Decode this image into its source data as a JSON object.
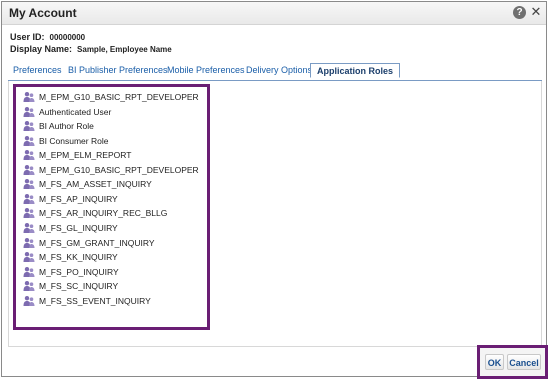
{
  "dialog": {
    "title": "My Account",
    "help_icon": "?",
    "close_icon": "✕"
  },
  "user": {
    "user_id_label": "User ID:",
    "user_id_value": "00000000",
    "display_name_label": "Display Name:",
    "display_name_value": "Sample, Employee Name"
  },
  "tabs": [
    {
      "label": "Preferences",
      "active": false
    },
    {
      "label": "BI Publisher Preferences",
      "active": false
    },
    {
      "label": "Mobile Preferences",
      "active": false
    },
    {
      "label": "Delivery Options",
      "active": false
    },
    {
      "label": "Application Roles",
      "active": true
    }
  ],
  "roles": [
    "M_EPM_G10_BASIC_RPT_DEVELOPER",
    "Authenticated User",
    "BI Author Role",
    "BI Consumer Role",
    "M_EPM_ELM_REPORT",
    "M_EPM_G10_BASIC_RPT_DEVELOPER",
    "M_FS_AM_ASSET_INQUIRY",
    "M_FS_AP_INQUIRY",
    "M_FS_AR_INQUIRY_REC_BLLG",
    "M_FS_GL_INQUIRY",
    "M_FS_GM_GRANT_INQUIRY",
    "M_FS_KK_INQUIRY",
    "M_FS_PO_INQUIRY",
    "M_FS_SC_INQUIRY",
    "M_FS_SS_EVENT_INQUIRY"
  ],
  "role_icon": "user-group-icon",
  "buttons": {
    "ok": "OK",
    "cancel": "Cancel"
  },
  "colors": {
    "highlight": "#6a1e74",
    "tab_text": "#1a5ea8",
    "role_icon": "#7d6bb0"
  }
}
